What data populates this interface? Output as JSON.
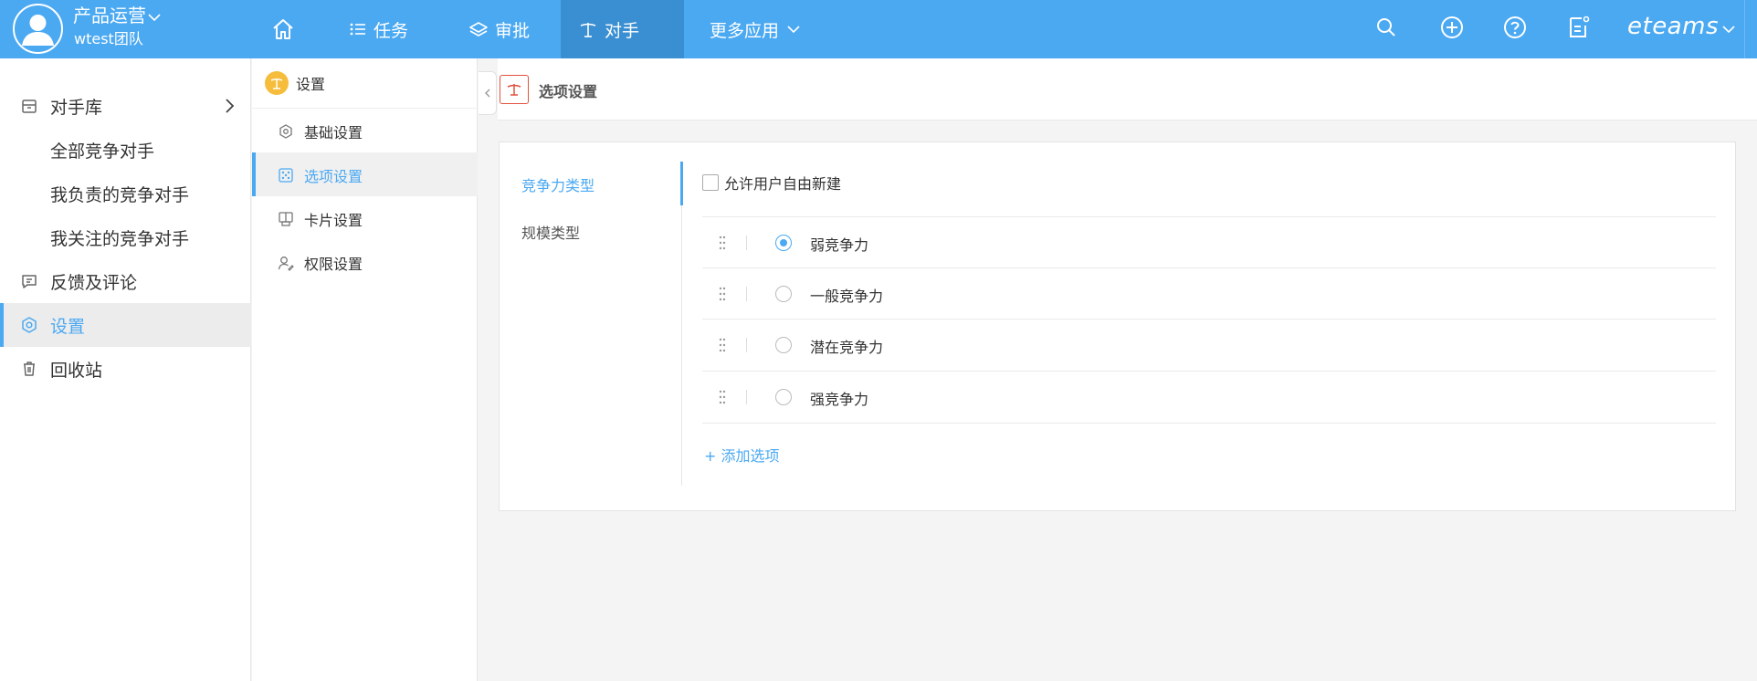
{
  "colors": {
    "brand": "#4ba9f2",
    "nav_active": "#3a8fd3",
    "accent_warn": "#e2513d",
    "settings_badge": "#f5bd3b"
  },
  "account": {
    "org": "产品运营",
    "team": "wtest团队"
  },
  "topnav": {
    "items": [
      {
        "label": "任务",
        "icon": "list-icon"
      },
      {
        "label": "审批",
        "icon": "layers-icon"
      },
      {
        "label": "对手",
        "icon": "scale-icon",
        "active": true
      },
      {
        "label": "更多应用",
        "icon": "chevron-down-icon"
      }
    ],
    "brand": "eteams"
  },
  "sidebar": {
    "items": [
      {
        "label": "对手库",
        "icon": "archive-icon"
      },
      {
        "label": "全部竞争对手"
      },
      {
        "label": "我负责的竞争对手"
      },
      {
        "label": "我关注的竞争对手"
      },
      {
        "label": "反馈及评论",
        "icon": "comment-icon"
      },
      {
        "label": "设置",
        "icon": "settings-icon",
        "active": true
      },
      {
        "label": "回收站",
        "icon": "trash-icon"
      }
    ]
  },
  "settings_panel": {
    "title": "设置",
    "items": [
      {
        "label": "基础设置",
        "icon": "basic-settings-icon"
      },
      {
        "label": "选项设置",
        "icon": "options-icon",
        "active": true
      },
      {
        "label": "卡片设置",
        "icon": "card-icon"
      },
      {
        "label": "权限设置",
        "icon": "permission-icon"
      }
    ]
  },
  "main": {
    "title": "选项设置",
    "types": [
      {
        "label": "竞争力类型",
        "active": true
      },
      {
        "label": "规模类型"
      }
    ],
    "allow_create_label": "允许用户自由新建",
    "options": [
      {
        "label": "弱竞争力",
        "selected": true
      },
      {
        "label": "一般竞争力"
      },
      {
        "label": "潜在竞争力"
      },
      {
        "label": "强竞争力"
      }
    ],
    "add_option_label": "+ 添加选项"
  }
}
